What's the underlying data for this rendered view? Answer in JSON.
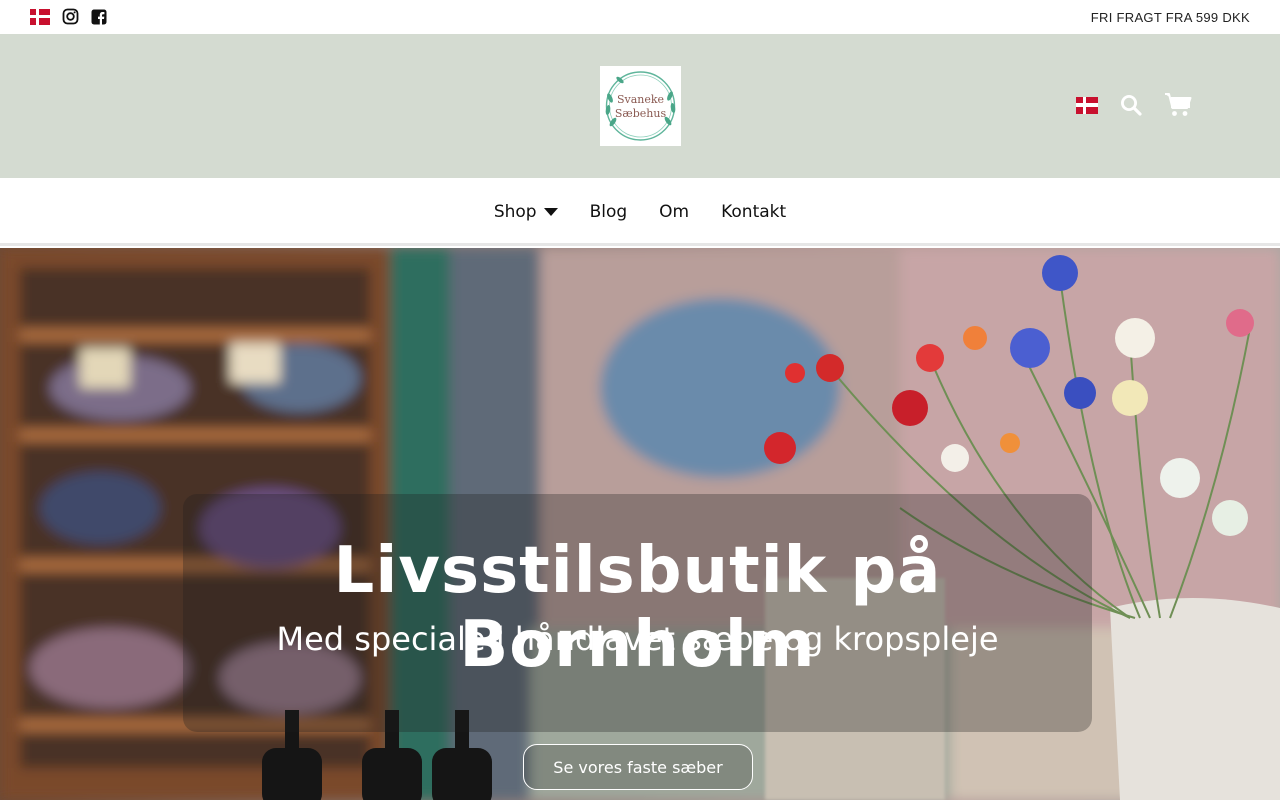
{
  "topbar": {
    "shipping_notice": "FRI FRAGT FRA 599 DKK",
    "icons": [
      "danish-flag-icon",
      "instagram-icon",
      "facebook-icon"
    ]
  },
  "header": {
    "logo": {
      "line1": "Svaneke",
      "line2": "Sæbehus"
    },
    "icons": [
      "danish-flag-icon",
      "search-icon",
      "cart-icon"
    ]
  },
  "nav": {
    "items": [
      {
        "label": "Shop",
        "has_dropdown": true
      },
      {
        "label": "Blog"
      },
      {
        "label": "Om"
      },
      {
        "label": "Kontakt"
      }
    ]
  },
  "hero": {
    "title": "Livsstilsbutik på Bornholm",
    "subtitle": "Med speciale i håndlavet sæbe og kropspleje",
    "cta_label": "Se vores faste sæber"
  },
  "colors": {
    "header_bg": "#d4dbd1",
    "logo_wreath": "#5fb59b",
    "logo_text": "#8a5a52",
    "flag_red": "#c8102e"
  }
}
